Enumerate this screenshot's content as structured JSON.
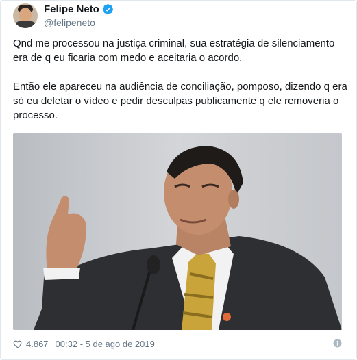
{
  "author": {
    "name": "Felipe Neto",
    "handle": "@felipeneto",
    "verified": true
  },
  "tweet": {
    "paragraph_1": "Qnd me processou na justiça criminal, sua estratégia de silenciamento era de q eu ficaria com medo e aceitaria o acordo.",
    "paragraph_2": "Então ele apareceu na audiência de conciliação, pomposo, dizendo q era só eu deletar o vídeo e pedir desculpas publicamente q ele removeria o processo."
  },
  "footer": {
    "likes": "4.867",
    "timestamp": "00:32 - 5 de ago de 2019"
  },
  "colors": {
    "verified": "#1da1f2",
    "secondary_text": "#657786",
    "border": "#e1e8ed"
  },
  "icons": {
    "verified": "verified-badge-icon",
    "like": "heart-icon",
    "info": "info-icon"
  }
}
